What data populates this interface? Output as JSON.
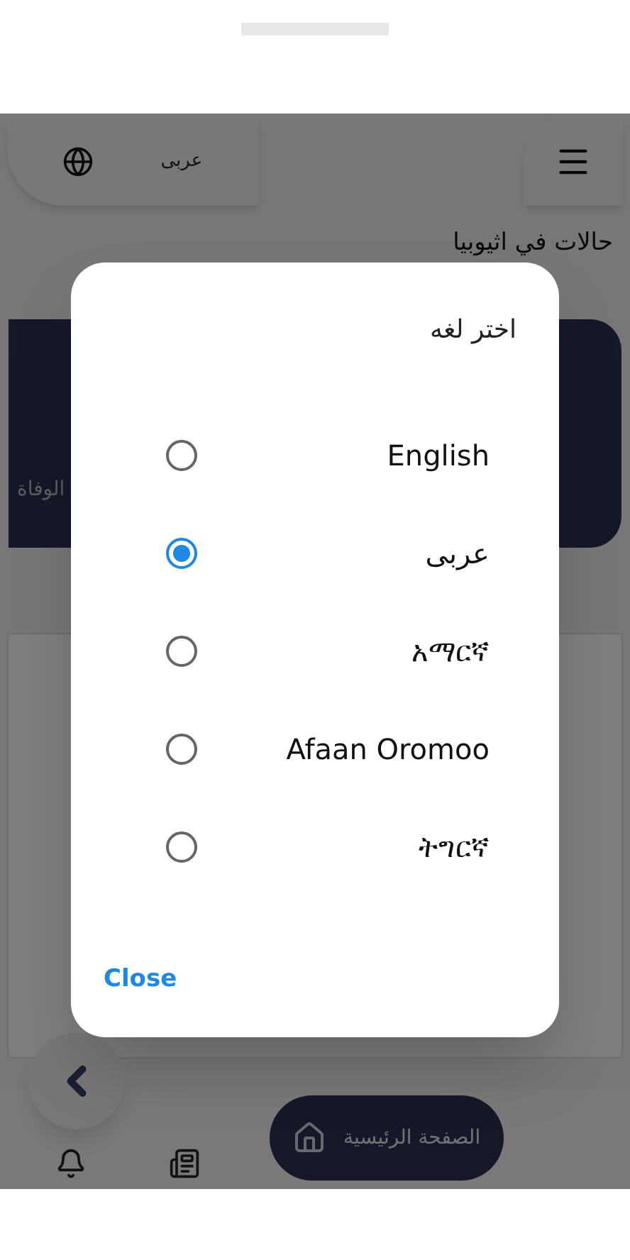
{
  "top_bar": {
    "language": "عربى"
  },
  "title": "حالات في اثيوبيا",
  "stats_card": {
    "label": "الوفاة"
  },
  "bottom_nav": [
    {
      "kind": "bell",
      "selected": false
    },
    {
      "kind": "news",
      "selected": false
    },
    {
      "kind": "home",
      "label": "الصفحة الرئيسية",
      "selected": true
    }
  ],
  "dialog": {
    "title": "اختر لغه",
    "options": [
      {
        "label": "English",
        "selected": false
      },
      {
        "label": "عربى",
        "selected": true
      },
      {
        "label": "አማርኛ",
        "selected": false
      },
      {
        "label": "Afaan Oromoo",
        "selected": false
      },
      {
        "label": "ትግርኛ",
        "selected": false
      }
    ],
    "close": "Close"
  }
}
